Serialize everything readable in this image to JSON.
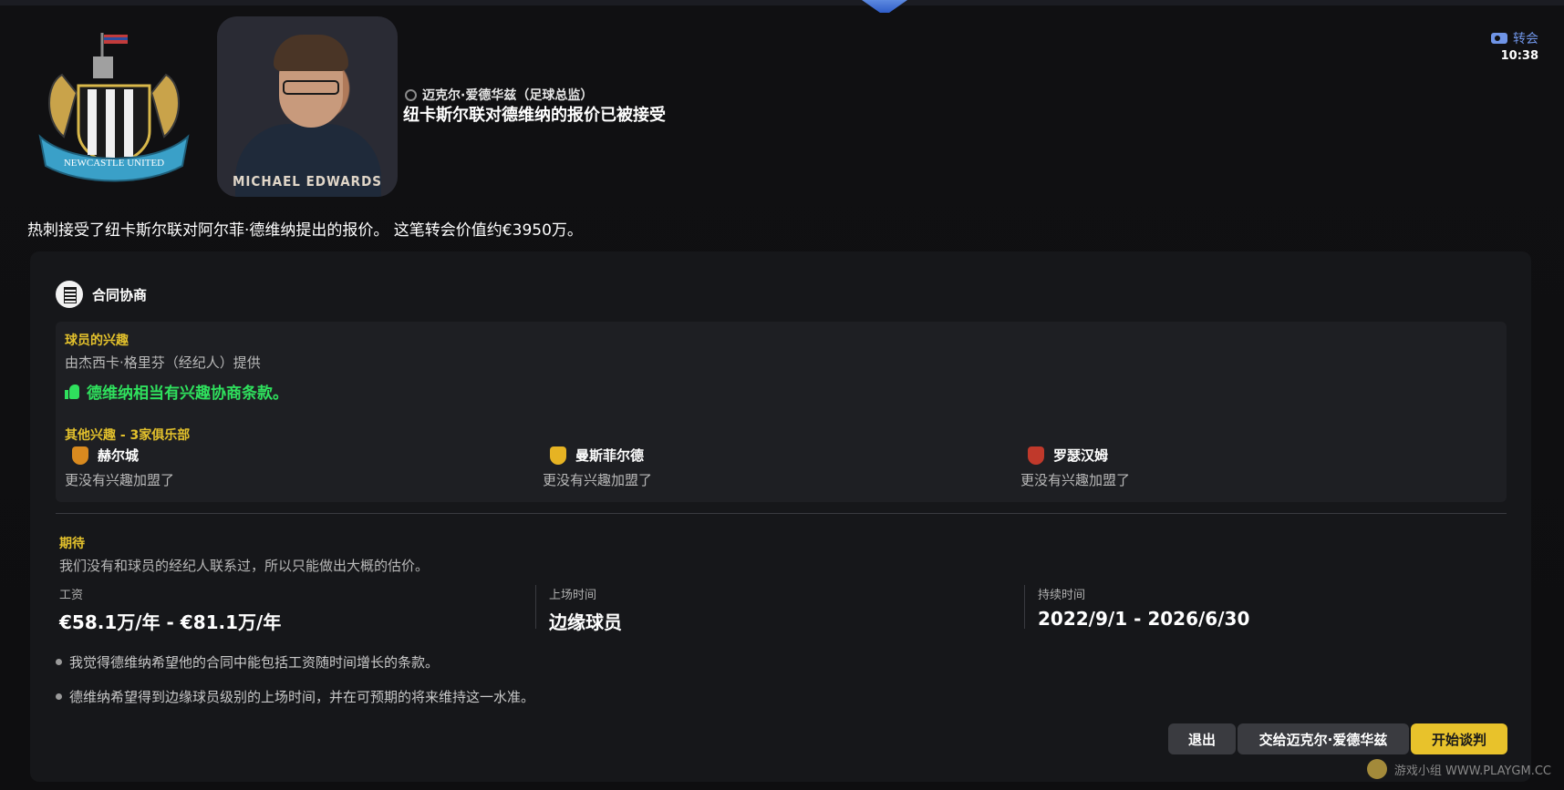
{
  "header": {
    "sender_name": "迈克尔·爱德华兹（足球总监）",
    "headline": "纽卡斯尔联对德维纳的报价已被接受",
    "avatar_caption": "MICHAEL EDWARDS",
    "crest_text": "NEWCASTLE UNITED",
    "category": "转会",
    "time": "10:38"
  },
  "summary": "热刺接受了纽卡斯尔联对阿尔菲·德维纳提出的报价。 这笔转会价值约€3950万。",
  "panel": {
    "title": "合同协商",
    "interest": {
      "title": "球员的兴趣",
      "provider": "由杰西卡·格里芬（经纪人）提供",
      "verdict": "德维纳相当有兴趣协商条款。",
      "others_title": "其他兴趣 - 3家俱乐部",
      "clubs": [
        {
          "name": "赫尔城",
          "note": "更没有兴趣加盟了",
          "color": "#d98a1f"
        },
        {
          "name": "曼斯菲尔德",
          "note": "更没有兴趣加盟了",
          "color": "#e6b323"
        },
        {
          "name": "罗瑟汉姆",
          "note": "更没有兴趣加盟了",
          "color": "#c0392b"
        }
      ]
    },
    "expectation": {
      "title": "期待",
      "description": "我们没有和球员的经纪人联系过，所以只能做出大概的估价。",
      "stats": [
        {
          "label": "工资",
          "value": "€58.1万/年 - €81.1万/年"
        },
        {
          "label": "上场时间",
          "value": "边缘球员"
        },
        {
          "label": "持续时间",
          "value": "2022/9/1 - 2026/6/30"
        }
      ],
      "bullets": [
        "我觉得德维纳希望他的合同中能包括工资随时间增长的条款。",
        "德维纳希望得到边缘球员级别的上场时间，并在可预期的将来维持这一水准。"
      ]
    },
    "buttons": {
      "exit": "退出",
      "delegate": "交给迈克尔·爱德华兹",
      "start": "开始谈判"
    }
  },
  "watermark": "游戏小组 WWW.PLAYGM.CC",
  "colors": {
    "accent_yellow": "#e8c22b",
    "verdict_green": "#2fe05d",
    "category_blue": "#6f94e6"
  }
}
